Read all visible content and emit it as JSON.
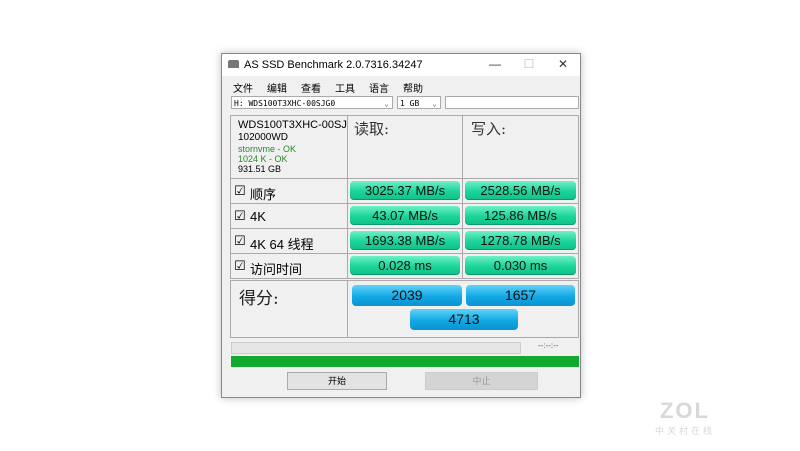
{
  "window": {
    "title": "AS SSD Benchmark 2.0.7316.34247",
    "minimize": "—",
    "maximize": "☐",
    "close": "✕"
  },
  "menu": [
    "文件",
    "编辑",
    "查看",
    "工具",
    "语言",
    "帮助"
  ],
  "drive_select": "H: WDS100T3XHC-00SJG0",
  "size_select": "1 GB",
  "chevron": "⌄",
  "info": {
    "model": "WDS100T3XHC-00SJ",
    "firmware": "102000WD",
    "driver": "stornvme - OK",
    "align": "1024 K - OK",
    "capacity": "931.51 GB"
  },
  "headers": {
    "read": "读取:",
    "write": "写入:"
  },
  "rows": [
    {
      "check": "☑",
      "label": "顺序",
      "read": "3025.37 MB/s",
      "write": "2528.56 MB/s"
    },
    {
      "check": "☑",
      "label": "4K",
      "read": "43.07 MB/s",
      "write": "125.86 MB/s"
    },
    {
      "check": "☑",
      "label": "4K 64 线程",
      "read": "1693.38 MB/s",
      "write": "1278.78 MB/s"
    },
    {
      "check": "☑",
      "label": "访问时间",
      "read": "0.028 ms",
      "write": "0.030 ms"
    }
  ],
  "score": {
    "label": "得分:",
    "read": "2039",
    "write": "1657",
    "total": "4713"
  },
  "progress": {
    "time": "--:--:--",
    "value": 1.0
  },
  "buttons": {
    "start": "开始",
    "stop": "中止"
  },
  "watermark": {
    "logo": "ZOL",
    "sub": "中关村在线"
  },
  "colors": {
    "green": "#1bd49a",
    "blue": "#12a8e4",
    "progress": "#13a82e"
  }
}
